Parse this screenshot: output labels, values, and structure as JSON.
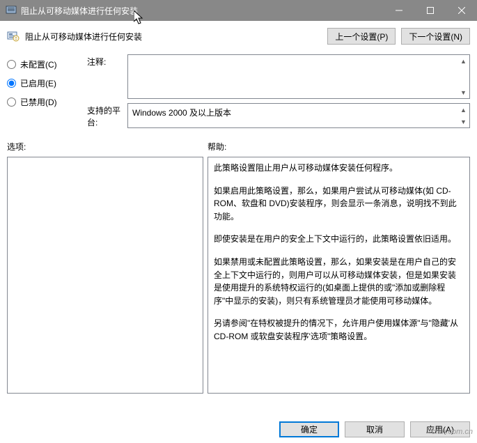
{
  "window": {
    "title": "阻止从可移动媒体进行任何安装"
  },
  "policy_name": "阻止从可移动媒体进行任何安装",
  "nav": {
    "prev": "上一个设置(P)",
    "next": "下一个设置(N)"
  },
  "radios": {
    "not_configured": "未配置(C)",
    "enabled": "已启用(E)",
    "disabled": "已禁用(D)",
    "selected": "enabled"
  },
  "labels": {
    "comment": "注释:",
    "supported": "支持的平台:",
    "options": "选项:",
    "help": "帮助:"
  },
  "supported_on": "Windows 2000 及以上版本",
  "help": {
    "p1": "此策略设置阻止用户从可移动媒体安装任何程序。",
    "p2": "如果启用此策略设置，那么，如果用户尝试从可移动媒体(如 CD-ROM、软盘和 DVD)安装程序，则会显示一条消息，说明找不到此功能。",
    "p3": "即使安装是在用户的安全上下文中运行的，此策略设置依旧适用。",
    "p4": "如果禁用或未配置此策略设置，那么，如果安装是在用户自己的安全上下文中运行的，则用户可以从可移动媒体安装，但是如果安装是使用提升的系统特权运行的(如桌面上提供的或\"添加或删除程序\"中显示的安装)，则只有系统管理员才能使用可移动媒体。",
    "p5": "另请参阅\"在特权被提升的情况下，允许用户使用媒体源\"与\"隐藏'从 CD-ROM 或软盘安装程序'选项\"策略设置。"
  },
  "buttons": {
    "ok": "确定",
    "cancel": "取消",
    "apply": "应用(A)"
  },
  "watermark": "cfan.com.cn"
}
